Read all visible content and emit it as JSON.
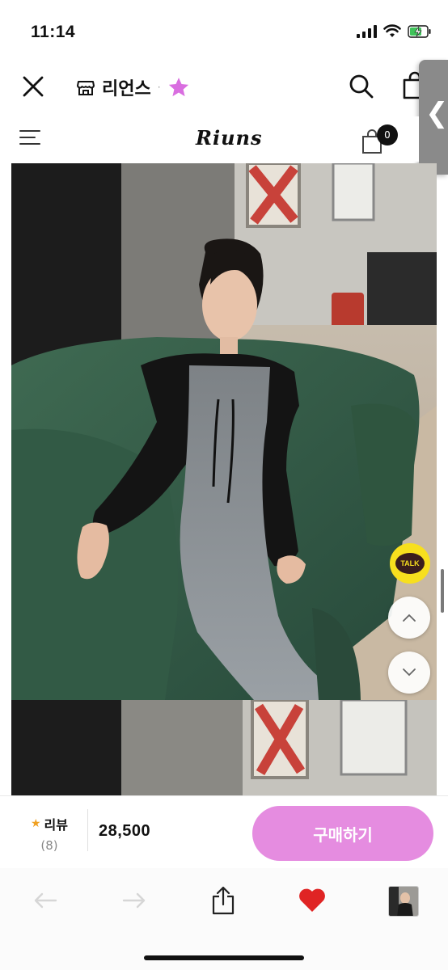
{
  "status_bar": {
    "time": "11:14",
    "icons": [
      "signal-icon",
      "wifi-icon",
      "battery-charging-icon"
    ]
  },
  "app_header": {
    "store_name": "리언스",
    "separator": "·",
    "icons": [
      "close-icon",
      "shop-icon",
      "star-icon",
      "search-icon",
      "shopping-bag-icon"
    ],
    "star_color": "#d96ee0"
  },
  "side_handle": {
    "glyph": "❮"
  },
  "shop_header": {
    "logo": "Riuns",
    "cart_count": "0",
    "icons": [
      "hamburger-menu-icon",
      "cart-icon"
    ]
  },
  "product_images": [
    {
      "alt": "model in black cardigan and gray knit dress on green sofa"
    },
    {
      "alt": "second product photo"
    }
  ],
  "floating_buttons": {
    "talk_label": "TALK",
    "icons": [
      "kakao-talk-icon",
      "chevron-up-icon",
      "chevron-down-icon"
    ],
    "talk_color": "#f7df1e"
  },
  "purchase_bar": {
    "review_label": "리뷰",
    "review_count": "(8)",
    "price": "28,500",
    "buy_label": "구매하기",
    "buy_color": "#e58ce0"
  },
  "bottom_toolbar": {
    "icons": [
      "back-arrow-icon",
      "forward-arrow-icon",
      "share-icon",
      "heart-icon",
      "tab-thumbnail"
    ],
    "heart_color": "#e02424"
  }
}
